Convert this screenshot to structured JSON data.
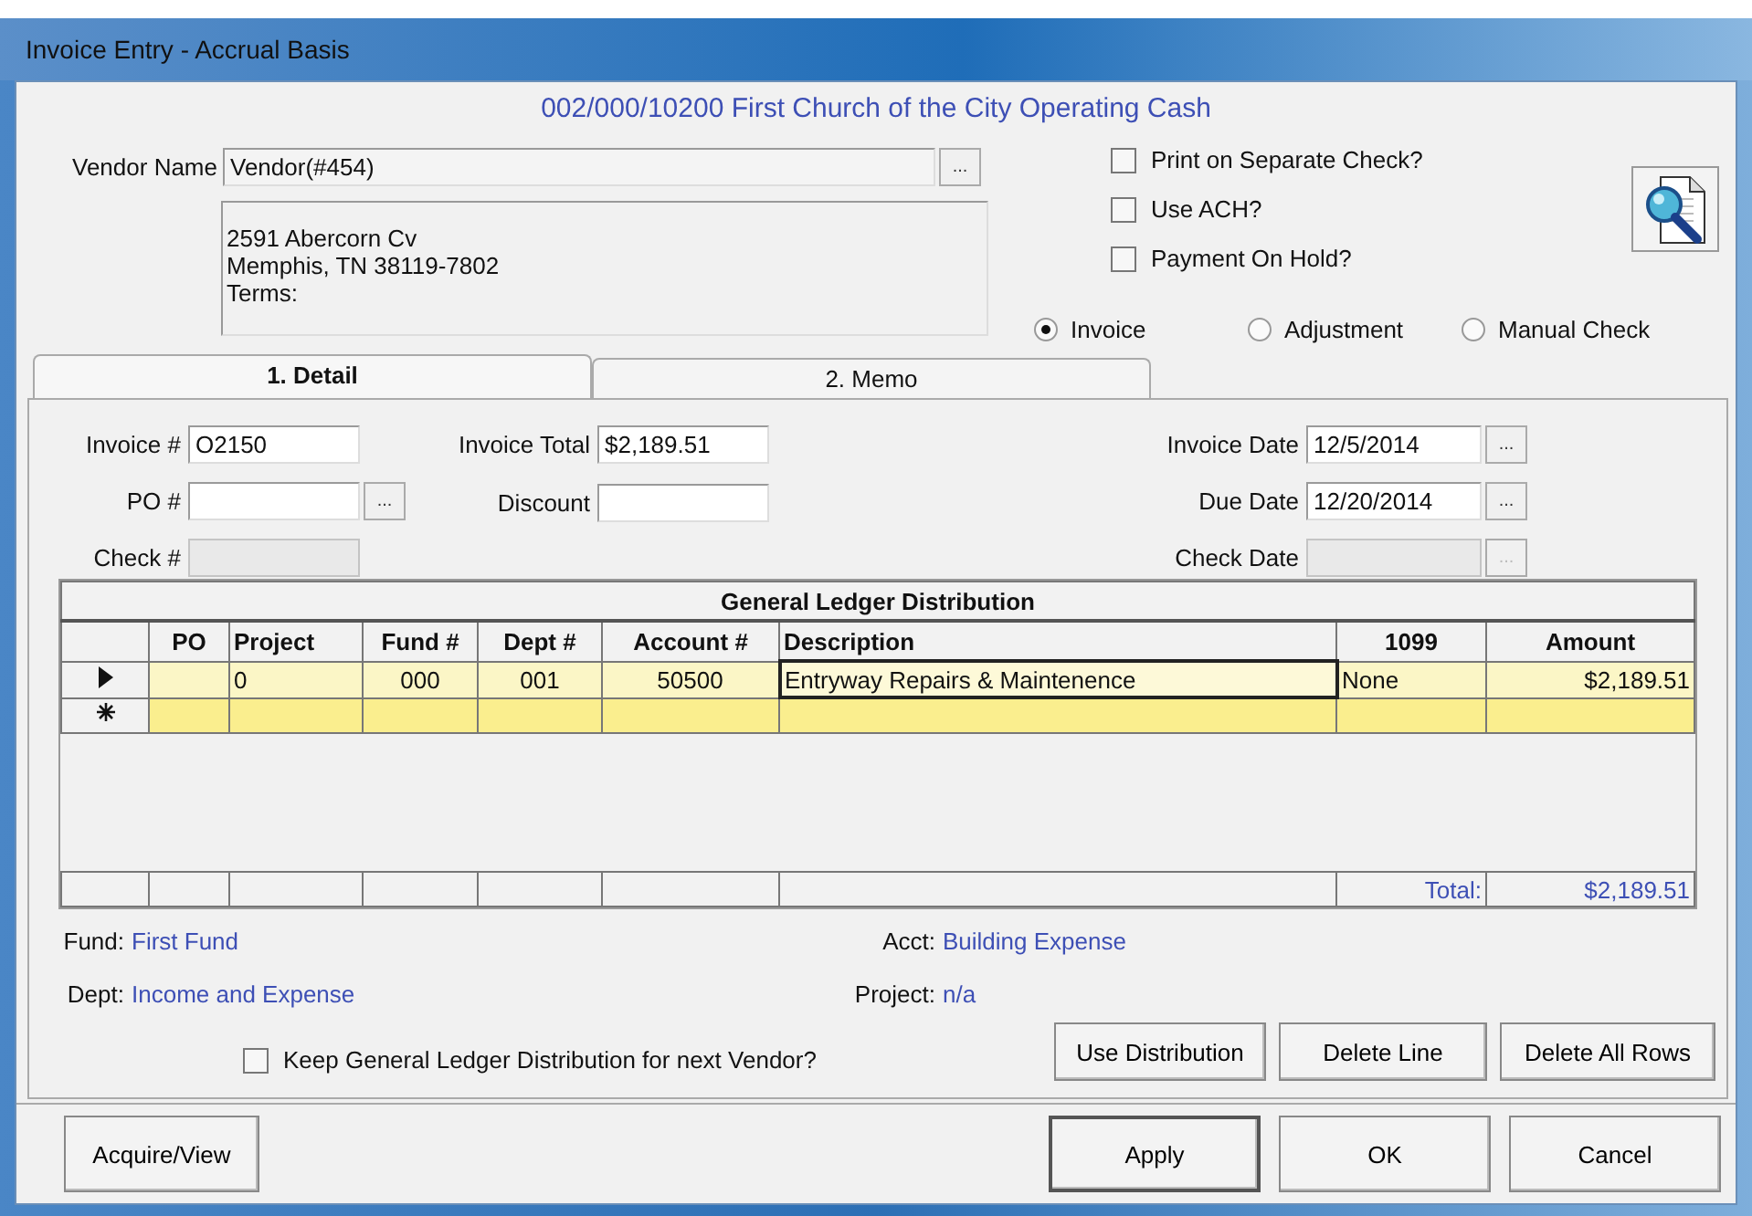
{
  "window": {
    "title": "Invoice Entry - Accrual Basis"
  },
  "account_header": "002/000/10200 First Church of the City Operating Cash",
  "vendor": {
    "label": "Vendor Name",
    "value": "Vendor(#454)",
    "browse": "...",
    "address_lines": [
      "2591 Abercorn Cv",
      "Memphis, TN   38119-7802",
      "Terms:"
    ]
  },
  "options": [
    {
      "label": "Print on Separate Check?",
      "checked": false
    },
    {
      "label": "Use ACH?",
      "checked": false
    },
    {
      "label": "Payment On Hold?",
      "checked": false
    }
  ],
  "entry_types": [
    {
      "label": "Invoice",
      "selected": true
    },
    {
      "label": "Adjustment",
      "selected": false
    },
    {
      "label": "Manual Check",
      "selected": false
    }
  ],
  "tabs": [
    {
      "label": "1. Detail",
      "selected": true
    },
    {
      "label": "2. Memo",
      "selected": false
    }
  ],
  "fields_left": [
    {
      "label": "Invoice #",
      "value": "O2150",
      "disabled": false
    },
    {
      "label": "PO #",
      "browse": "...",
      "disabled": false
    },
    {
      "label": "Check #",
      "disabled": true
    }
  ],
  "fields_middle": [
    {
      "label": "Invoice Total",
      "value": "$2,189.51",
      "disabled": false
    },
    {
      "label": "Discount",
      "disabled": false
    }
  ],
  "fields_right": [
    {
      "label": "Invoice Date",
      "value": "12/5/2014",
      "browse": "...",
      "disabled": false
    },
    {
      "label": "Due Date",
      "value": "12/20/2014",
      "browse": "...",
      "disabled": false
    },
    {
      "label": "Check Date",
      "browse": "...",
      "disabled": true
    }
  ],
  "grid": {
    "title": "General Ledger Distribution",
    "columns": [
      "PO",
      "Project",
      "Fund #",
      "Dept #",
      "Account #",
      "Description",
      "1099",
      "Amount"
    ],
    "rows": [
      {
        "kind": "data",
        "current": true,
        "cells": [
          {
            "text": "",
            "focused": false
          },
          {
            "text": "0",
            "focused": false
          },
          {
            "text": "000",
            "focused": false
          },
          {
            "text": "001",
            "focused": false
          },
          {
            "text": "50500",
            "focused": false
          },
          {
            "text": "Entryway Repairs & Maintenence",
            "focused": true
          },
          {
            "text": "None",
            "focused": false
          },
          {
            "text": "$2,189.51",
            "focused": false
          }
        ]
      },
      {
        "kind": "new",
        "current": false,
        "cells": []
      }
    ],
    "total_label": "Total:",
    "total": "$2,189.51"
  },
  "info": [
    {
      "label": "Fund:",
      "value": "First Fund"
    },
    {
      "label": "Acct:",
      "value": "Building Expense"
    },
    {
      "label": "Dept:",
      "value": "Income and Expense"
    },
    {
      "label": "Project:",
      "value": "n/a"
    }
  ],
  "keep_distribution": {
    "label": "Keep General Ledger Distribution for next Vendor?",
    "checked": false
  },
  "grid_buttons": [
    "Use Distribution",
    "Delete Line",
    "Delete All Rows"
  ],
  "footer": {
    "left_button": "Acquire/View",
    "buttons": [
      "Apply",
      "OK",
      "Cancel"
    ]
  }
}
